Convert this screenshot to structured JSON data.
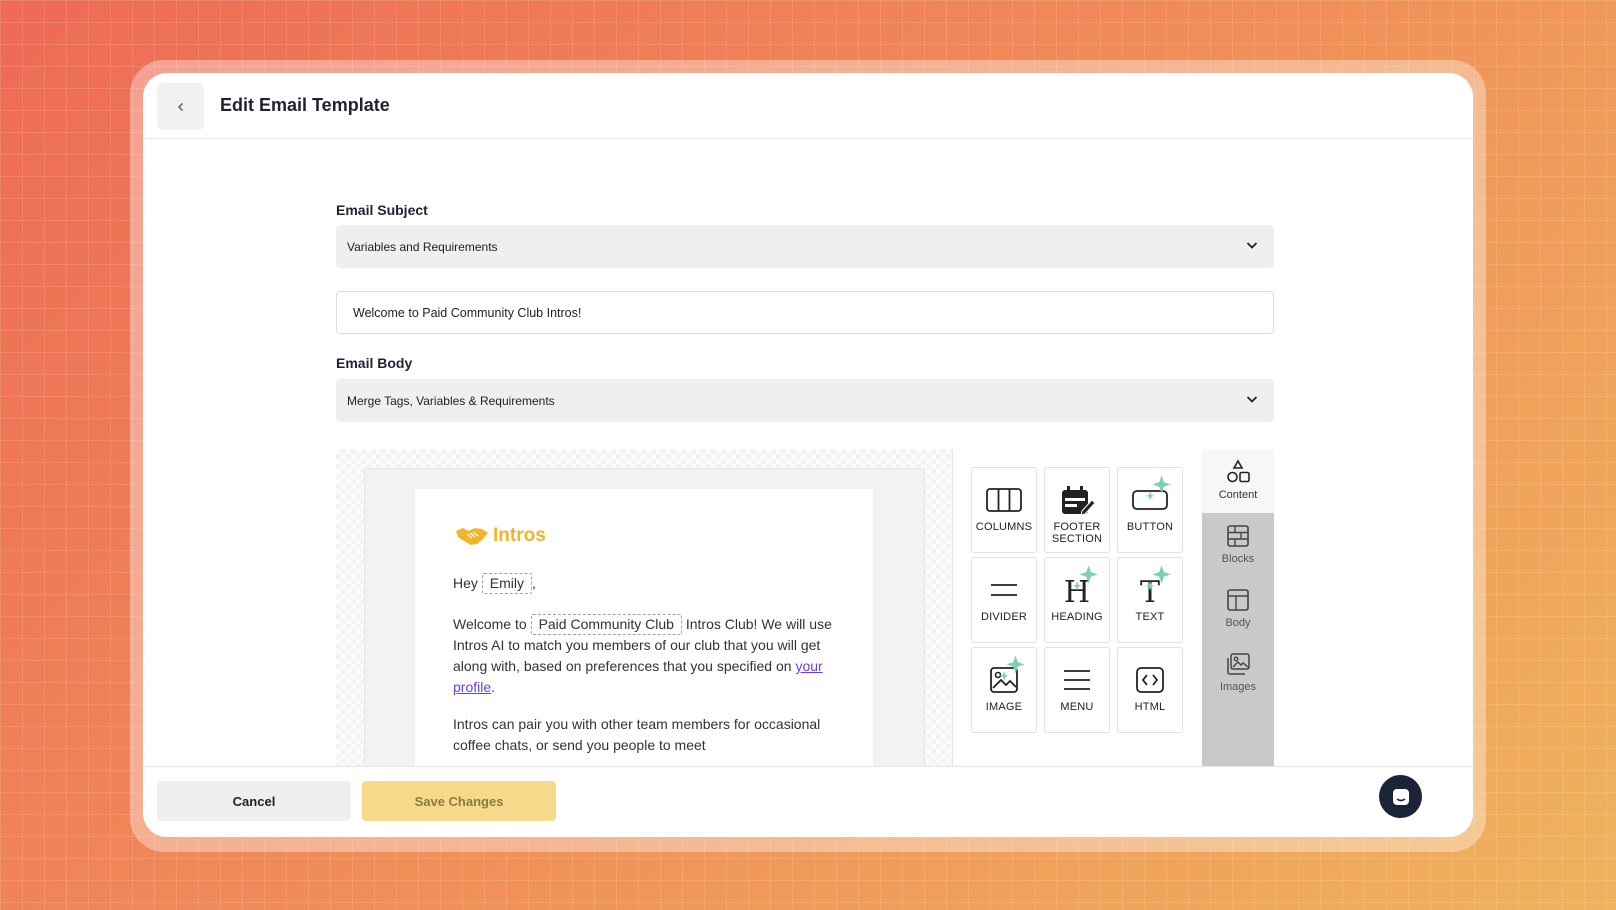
{
  "header": {
    "title": "Edit Email Template",
    "back_icon": "chevron-left-icon"
  },
  "subject": {
    "label": "Email Subject",
    "accordion": "Variables and Requirements",
    "value": "Welcome to Paid Community Club Intros!"
  },
  "body": {
    "label": "Email Body",
    "accordion": "Merge Tags, Variables & Requirements"
  },
  "email_preview": {
    "logo_text": "Intros",
    "greeting_prefix": "Hey",
    "name_tag": "Emily",
    "greeting_suffix": ",",
    "p1_prefix": "Welcome to",
    "club_tag": "Paid Community Club",
    "p1_rest": "Intros Club! We will use Intros AI to match you members of our club that you will get along with, based on preferences that you specified on",
    "p1_link": "your profile",
    "p1_end": ".",
    "p2": "Intros can pair you with other team members for occasional coffee chats, or send you people to meet"
  },
  "tools": [
    {
      "label": "COLUMNS",
      "icon": "columns-icon"
    },
    {
      "label": "FOOTER SECTION",
      "icon": "footer-section-icon"
    },
    {
      "label": "BUTTON",
      "icon": "button-icon"
    },
    {
      "label": "DIVIDER",
      "icon": "divider-icon"
    },
    {
      "label": "HEADING",
      "icon": "heading-icon"
    },
    {
      "label": "TEXT",
      "icon": "text-icon"
    },
    {
      "label": "IMAGE",
      "icon": "image-icon"
    },
    {
      "label": "MENU",
      "icon": "menu-icon"
    },
    {
      "label": "HTML",
      "icon": "html-icon"
    }
  ],
  "side_tabs": [
    {
      "label": "Content",
      "icon": "shapes-icon",
      "active": true
    },
    {
      "label": "Blocks",
      "icon": "blocks-icon"
    },
    {
      "label": "Body",
      "icon": "body-layout-icon"
    },
    {
      "label": "Images",
      "icon": "images-icon"
    }
  ],
  "footer": {
    "cancel": "Cancel",
    "save": "Save Changes"
  },
  "colors": {
    "accent": "#f7d98a",
    "link": "#6a3cf0",
    "brand": "#f2b42a",
    "chat": "#1b2437"
  }
}
